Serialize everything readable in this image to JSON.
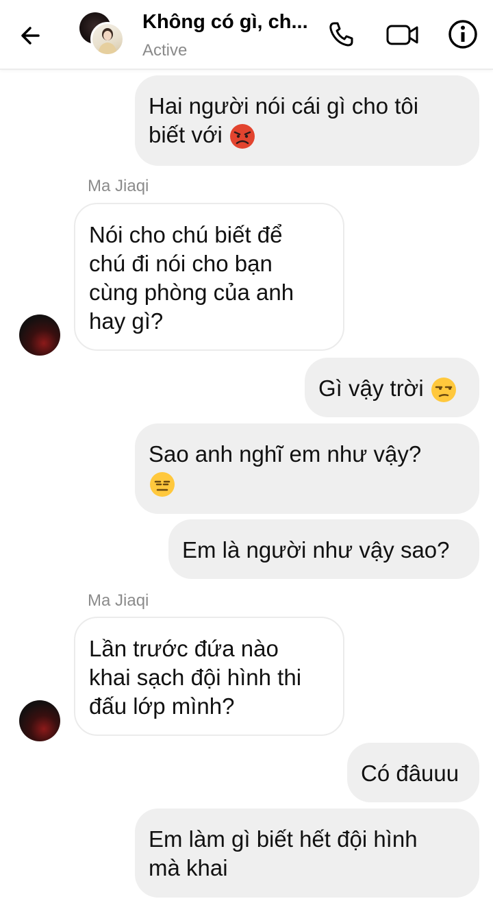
{
  "header": {
    "title": "Không có gì, ch...",
    "status": "Active"
  },
  "colors": {
    "outgoing_bubble": "#efefef",
    "incoming_bubble": "#ffffff",
    "secondary_text": "#8a8a8a",
    "emoji_angry": "#e2442f",
    "emoji_yellow": "#ffc83d"
  },
  "icons": [
    "back-arrow-icon",
    "phone-icon",
    "video-camera-icon",
    "info-icon"
  ],
  "messages": [
    {
      "direction": "outgoing",
      "lines": [
        "Hai người nói cái gì cho tôi",
        "biết với"
      ],
      "emoji": "pouting-face"
    },
    {
      "direction": "incoming",
      "sender": "Ma Jiaqi",
      "lines": [
        "Nói cho chú biết để",
        "chú đi nói cho bạn",
        "cùng phòng của anh",
        "hay gì?"
      ]
    },
    {
      "direction": "outgoing",
      "lines": [
        "Gì vậy trời"
      ],
      "emoji": "unamused-face"
    },
    {
      "direction": "outgoing",
      "lines": [
        "Sao anh nghĩ em như vậy?"
      ],
      "emoji": "expressionless-face"
    },
    {
      "direction": "outgoing",
      "lines": [
        "Em là người như vậy sao?"
      ]
    },
    {
      "direction": "incoming",
      "sender": "Ma Jiaqi",
      "lines": [
        "Lần trước đứa nào",
        "khai sạch đội hình thi",
        "đấu lớp mình?"
      ]
    },
    {
      "direction": "outgoing",
      "lines": [
        "Có đâuuu"
      ]
    },
    {
      "direction": "outgoing",
      "lines": [
        "Em làm gì biết hết đội hình",
        "mà khai"
      ]
    }
  ]
}
